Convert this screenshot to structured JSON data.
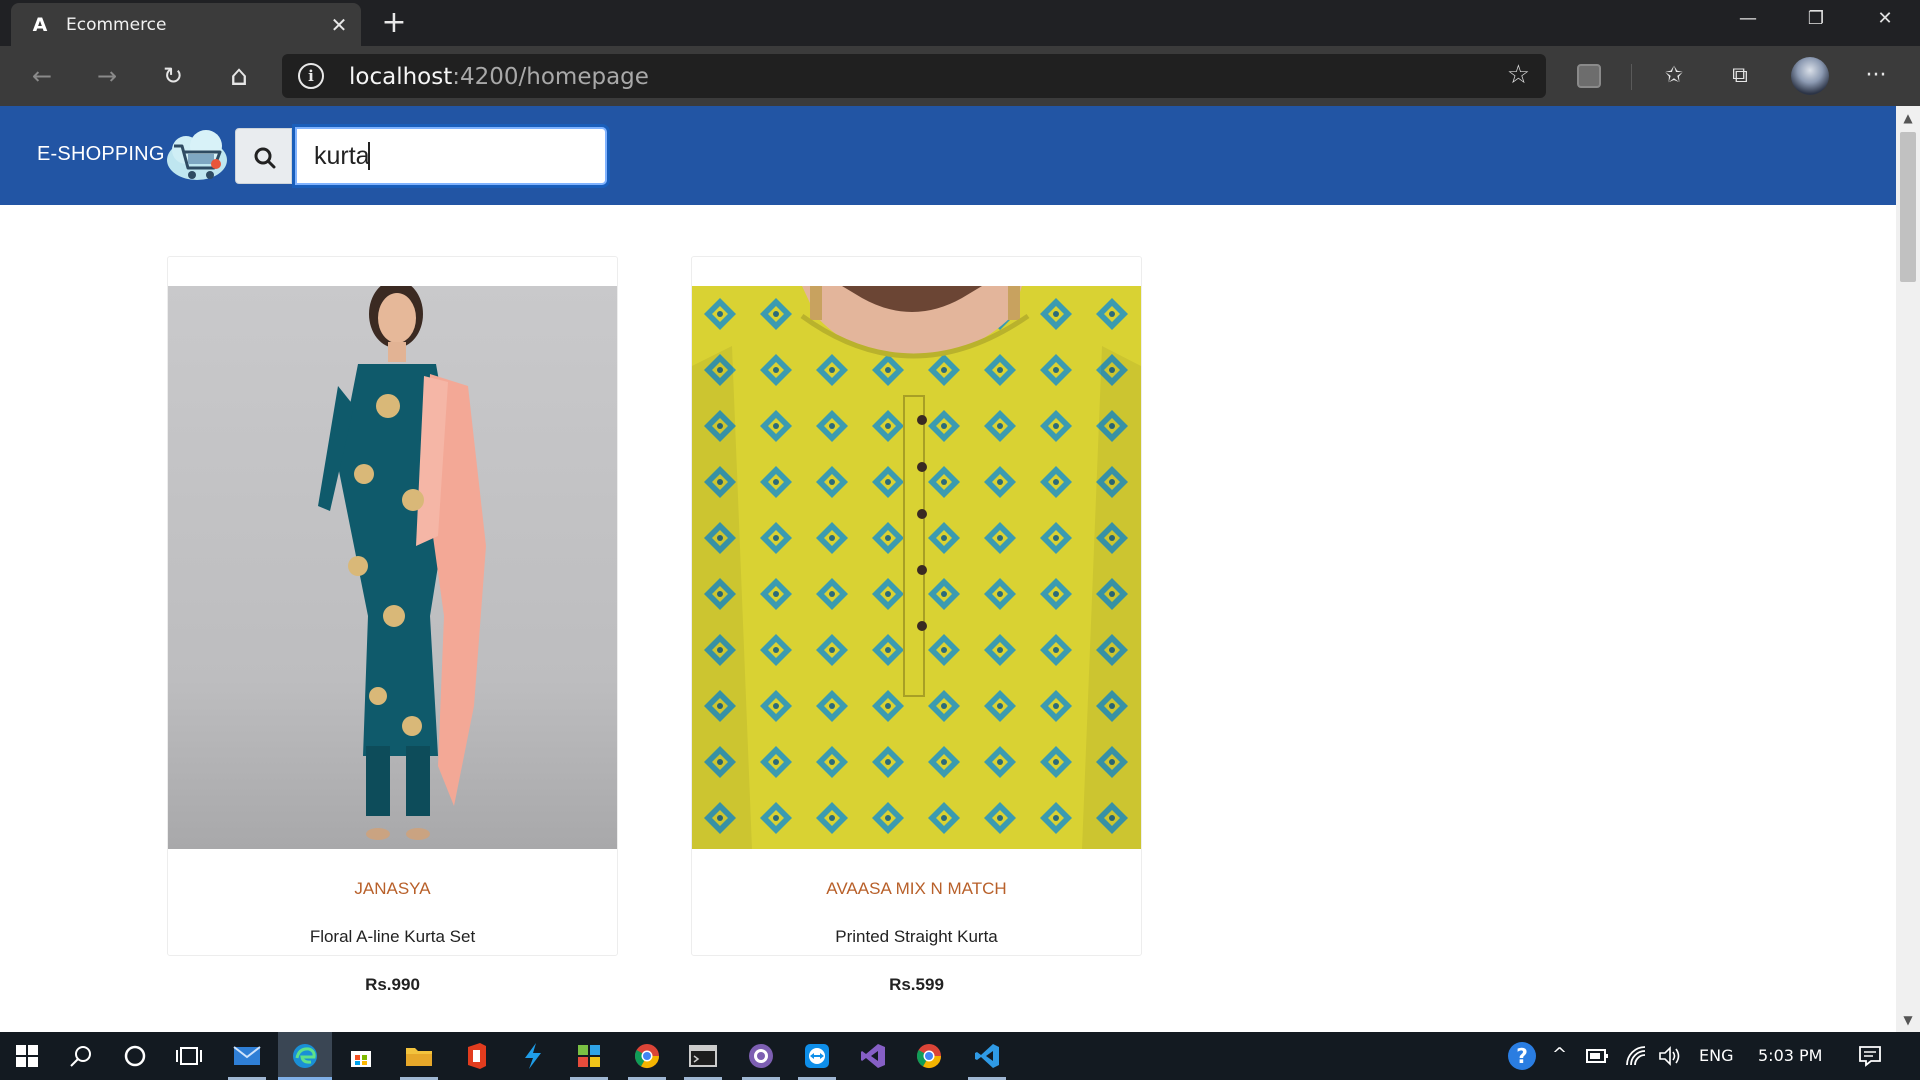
{
  "browser": {
    "tab": {
      "title": "Ecommerce",
      "favicon_letter": "A",
      "close": "✕"
    },
    "new_tab": "+",
    "window_controls": {
      "minimize": "—",
      "restore": "❐",
      "close": "✕"
    },
    "nav": {
      "back": "←",
      "forward": "→",
      "reload": "↻",
      "home": "⌂"
    },
    "address": {
      "host": "localhost",
      "path": ":4200/homepage",
      "info": "i",
      "favorite": "☆"
    },
    "toolbar_icons": {
      "favorites": "✩",
      "collections": "⧉",
      "more": "···"
    }
  },
  "site": {
    "brand": "E-SHOPPING",
    "search": {
      "value": "kurta",
      "placeholder": ""
    },
    "colors": {
      "header": "#2255a4",
      "brand_text": "#b8602a"
    }
  },
  "products": [
    {
      "brand": "JANASYA",
      "name": "Floral A-line Kurta Set",
      "price": "Rs.990"
    },
    {
      "brand": "AVAASA MIX N MATCH",
      "name": "Printed Straight Kurta",
      "price": "Rs.599"
    }
  ],
  "taskbar": {
    "apps": [
      "start-icon",
      "search-icon",
      "cortana-icon",
      "task-view-icon",
      "mail-icon",
      "edge-icon",
      "store-icon",
      "file-explorer-icon",
      "office-icon",
      "vs-code-insiders-icon",
      "mindmap-icon",
      "chrome-icon",
      "terminal-icon",
      "app-icon",
      "teamviewer-icon",
      "visual-studio-icon",
      "chrome-icon",
      "vscode-icon"
    ],
    "tray": {
      "language": "ENG",
      "time": "5:03 PM"
    }
  }
}
